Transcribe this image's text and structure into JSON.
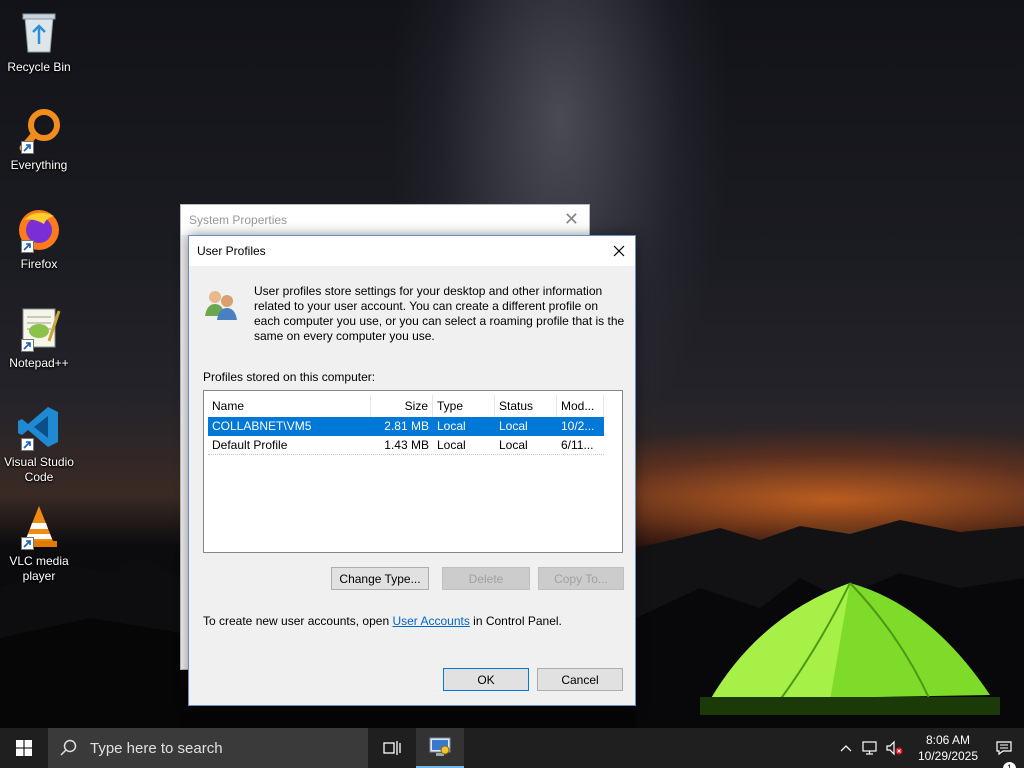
{
  "desktop": {
    "icons": [
      {
        "label": "Recycle Bin",
        "icon": "recycle-bin-icon"
      },
      {
        "label": "Everything",
        "icon": "everything-search-icon"
      },
      {
        "label": "Firefox",
        "icon": "firefox-icon"
      },
      {
        "label": "Notepad++",
        "icon": "notepadpp-icon"
      },
      {
        "label": "Visual Studio Code",
        "icon": "vscode-icon"
      },
      {
        "label": "VLC media player",
        "icon": "vlc-icon"
      }
    ]
  },
  "system_properties": {
    "title": "System Properties"
  },
  "dialog": {
    "title": "User Profiles",
    "description": "User profiles store settings for your desktop and other information related to your user account. You can create a different profile on each computer you use, or you can select a roaming profile that is the same on every computer you use.",
    "profiles_label": "Profiles stored on this computer:",
    "columns": [
      "Name",
      "Size",
      "Type",
      "Status",
      "Mod..."
    ],
    "rows": [
      {
        "name": "COLLABNET\\VM5",
        "size": "2.81 MB",
        "type": "Local",
        "status": "Local",
        "modified": "10/2...",
        "selected": true
      },
      {
        "name": "Default Profile",
        "size": "1.43 MB",
        "type": "Local",
        "status": "Local",
        "modified": "6/11...",
        "selected": false
      }
    ],
    "buttons": {
      "change_type": "Change Type...",
      "delete": "Delete",
      "copy_to": "Copy To...",
      "ok": "OK",
      "cancel": "Cancel"
    },
    "footer_prefix": "To create new user accounts, open ",
    "footer_link": "User Accounts",
    "footer_suffix": " in Control Panel."
  },
  "taskbar": {
    "search_placeholder": "Type here to search",
    "time": "8:06 AM",
    "date": "10/29/2025",
    "notification_count": "1"
  },
  "colors": {
    "selection": "#0078d7",
    "link": "#0066cc",
    "taskbar": "#1f1f1f"
  }
}
